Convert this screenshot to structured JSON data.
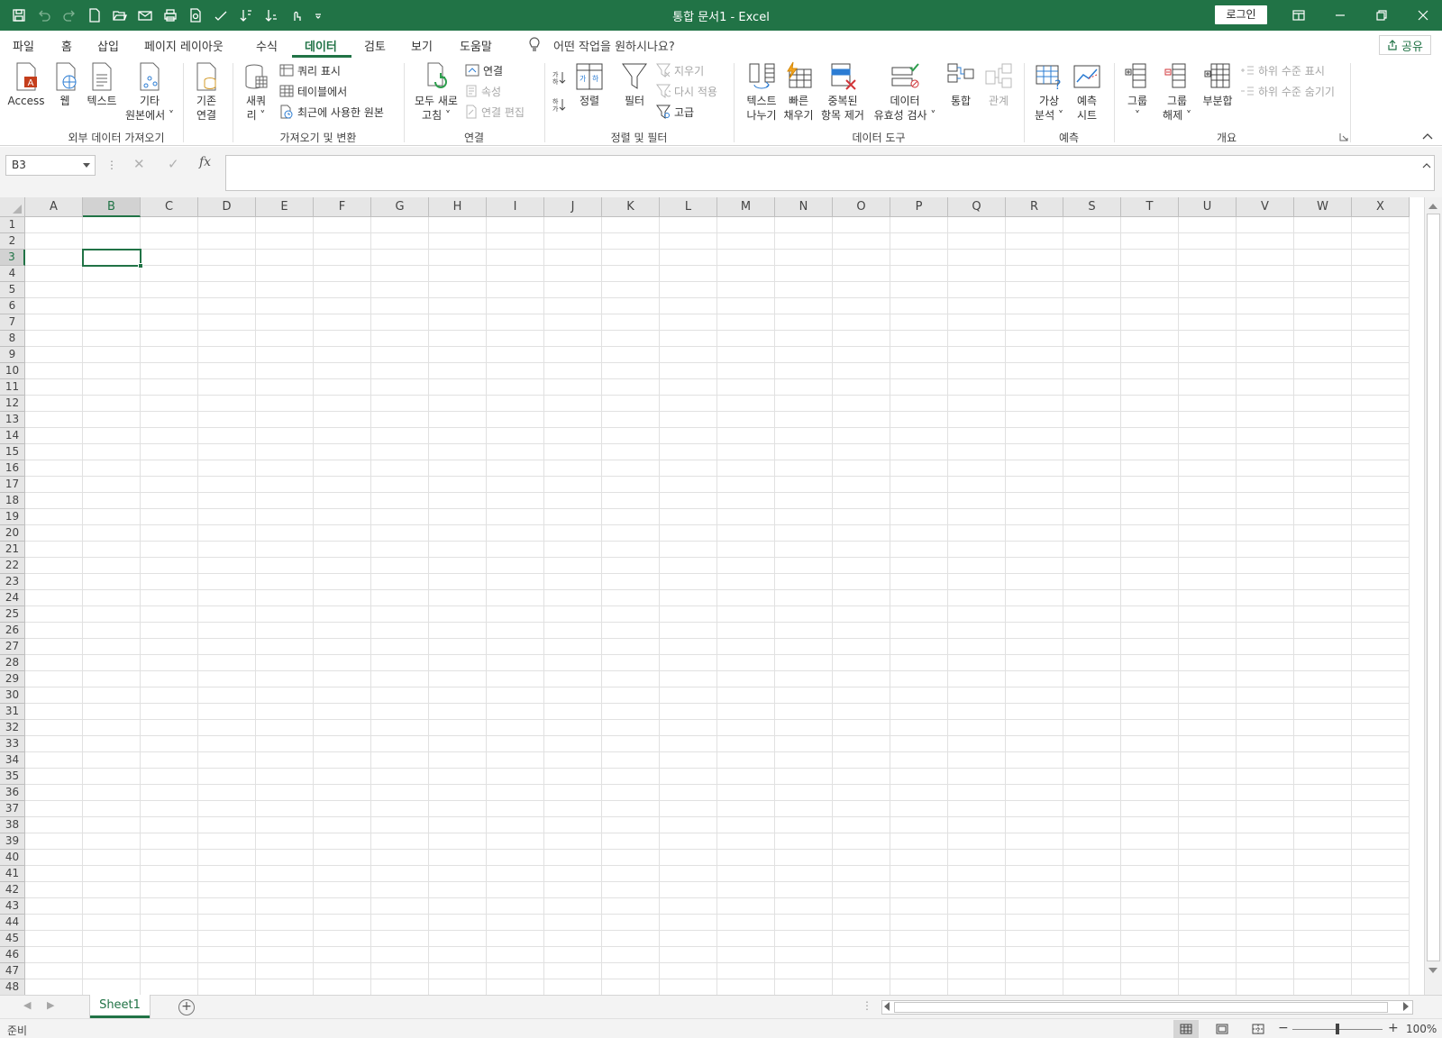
{
  "window": {
    "title": "통합 문서1  -  Excel",
    "login_label": "로그인"
  },
  "tabs": [
    "파일",
    "홈",
    "삽입",
    "페이지 레이아웃",
    "수식",
    "데이터",
    "검토",
    "보기",
    "도움말"
  ],
  "active_tab": "데이터",
  "tell_me": "어떤 작업을 원하시나요?",
  "share_label": "공유",
  "ribbon": {
    "groups": {
      "external": "외부 데이터 가져오기",
      "transform": "가져오기 및 변환",
      "connections": "연결",
      "sortfilter": "정렬 및 필터",
      "datatools": "데이터 도구",
      "forecast": "예측",
      "outline": "개요"
    },
    "buttons": {
      "access": "Access",
      "web": "웹",
      "text": "텍스트",
      "other_sources_1": "기타",
      "other_sources_2": "원본에서",
      "existing_1": "기존",
      "existing_2": "연결",
      "new_query_1": "새쿼",
      "new_query_2": "리",
      "show_queries": "쿼리 표시",
      "from_table": "테이블에서",
      "recent_sources": "최근에 사용한 원본",
      "refresh_all_1": "모두 새로",
      "refresh_all_2": "고침",
      "connections": "연결",
      "properties": "속성",
      "edit_links": "연결 편집",
      "sort": "정렬",
      "filter": "필터",
      "clear": "지우기",
      "reapply": "다시 적용",
      "advanced": "고급",
      "text_to_columns_1": "텍스트",
      "text_to_columns_2": "나누기",
      "flash_fill_1": "빠른",
      "flash_fill_2": "채우기",
      "remove_dup_1": "중복된",
      "remove_dup_2": "항목 제거",
      "validation_1": "데이터",
      "validation_2": "유효성 검사",
      "consolidate": "통합",
      "relationships": "관계",
      "whatif_1": "가상",
      "whatif_2": "분석",
      "forecast_1": "예측",
      "forecast_2": "시트",
      "group": "그룹",
      "ungroup_1": "그룹",
      "ungroup_2": "해제",
      "subtotal": "부분합",
      "show_detail": "하위 수준 표시",
      "hide_detail": "하위 수준 숨기기"
    }
  },
  "formula_bar": {
    "name_box": "B3",
    "fx": "fx",
    "content": ""
  },
  "grid": {
    "columns": [
      "A",
      "B",
      "C",
      "D",
      "E",
      "F",
      "G",
      "H",
      "I",
      "J",
      "K",
      "L",
      "M",
      "N",
      "O",
      "P",
      "Q",
      "R",
      "S",
      "T",
      "U",
      "V",
      "W",
      "X"
    ],
    "row_count": 48,
    "selected_cell": "B3"
  },
  "sheets": [
    "Sheet1"
  ],
  "status": {
    "ready": "준비",
    "zoom": "100%"
  },
  "colors": {
    "accent": "#217346",
    "gridline": "#e1e1e1",
    "header_bg": "#e6e6e6"
  }
}
